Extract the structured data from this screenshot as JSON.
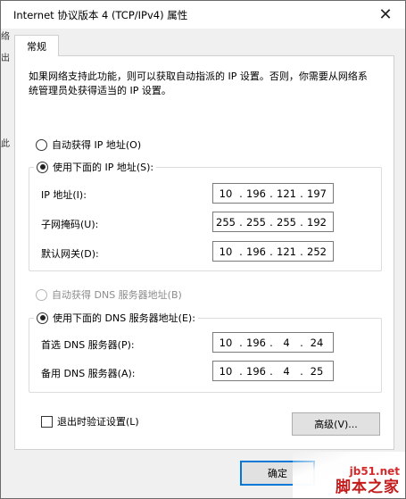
{
  "window": {
    "title": "Internet 协议版本 4 (TCP/IPv4) 属性",
    "close_glyph": "✕"
  },
  "tabs": {
    "general": "常规"
  },
  "description": "如果网络支持此功能，则可以获取自动指派的 IP 设置。否则，你需要从网络系统管理员处获得适当的 IP 设置。",
  "ip_mode": {
    "auto_label": "自动获得 IP 地址(O)",
    "manual_label": "使用下面的 IP 地址(S):",
    "selected": "manual"
  },
  "ip_fields": [
    {
      "label": "IP 地址(I):",
      "octets": [
        "10",
        "196",
        "121",
        "197"
      ]
    },
    {
      "label": "子网掩码(U):",
      "octets": [
        "255",
        "255",
        "255",
        "192"
      ]
    },
    {
      "label": "默认网关(D):",
      "octets": [
        "10",
        "196",
        "121",
        "252"
      ]
    }
  ],
  "dns_mode": {
    "auto_label": "自动获得 DNS 服务器地址(B)",
    "manual_label": "使用下面的 DNS 服务器地址(E):",
    "selected": "manual"
  },
  "dns_fields": [
    {
      "label": "首选 DNS 服务器(P):",
      "octets": [
        "10",
        "196",
        "4",
        "24"
      ]
    },
    {
      "label": "备用 DNS 服务器(A):",
      "octets": [
        "10",
        "196",
        "4",
        "25"
      ]
    }
  ],
  "validate_on_exit": {
    "label": "退出时验证设置(L)",
    "checked": false
  },
  "buttons": {
    "advanced": "高级(V)...",
    "ok": "确定"
  },
  "background": {
    "chars": [
      "络",
      "出",
      "此"
    ]
  },
  "watermark": {
    "site": "jb51.net",
    "brand": "脚本之家"
  },
  "colors": {
    "accent": "#0078d7",
    "watermark": "#d62a2a"
  }
}
